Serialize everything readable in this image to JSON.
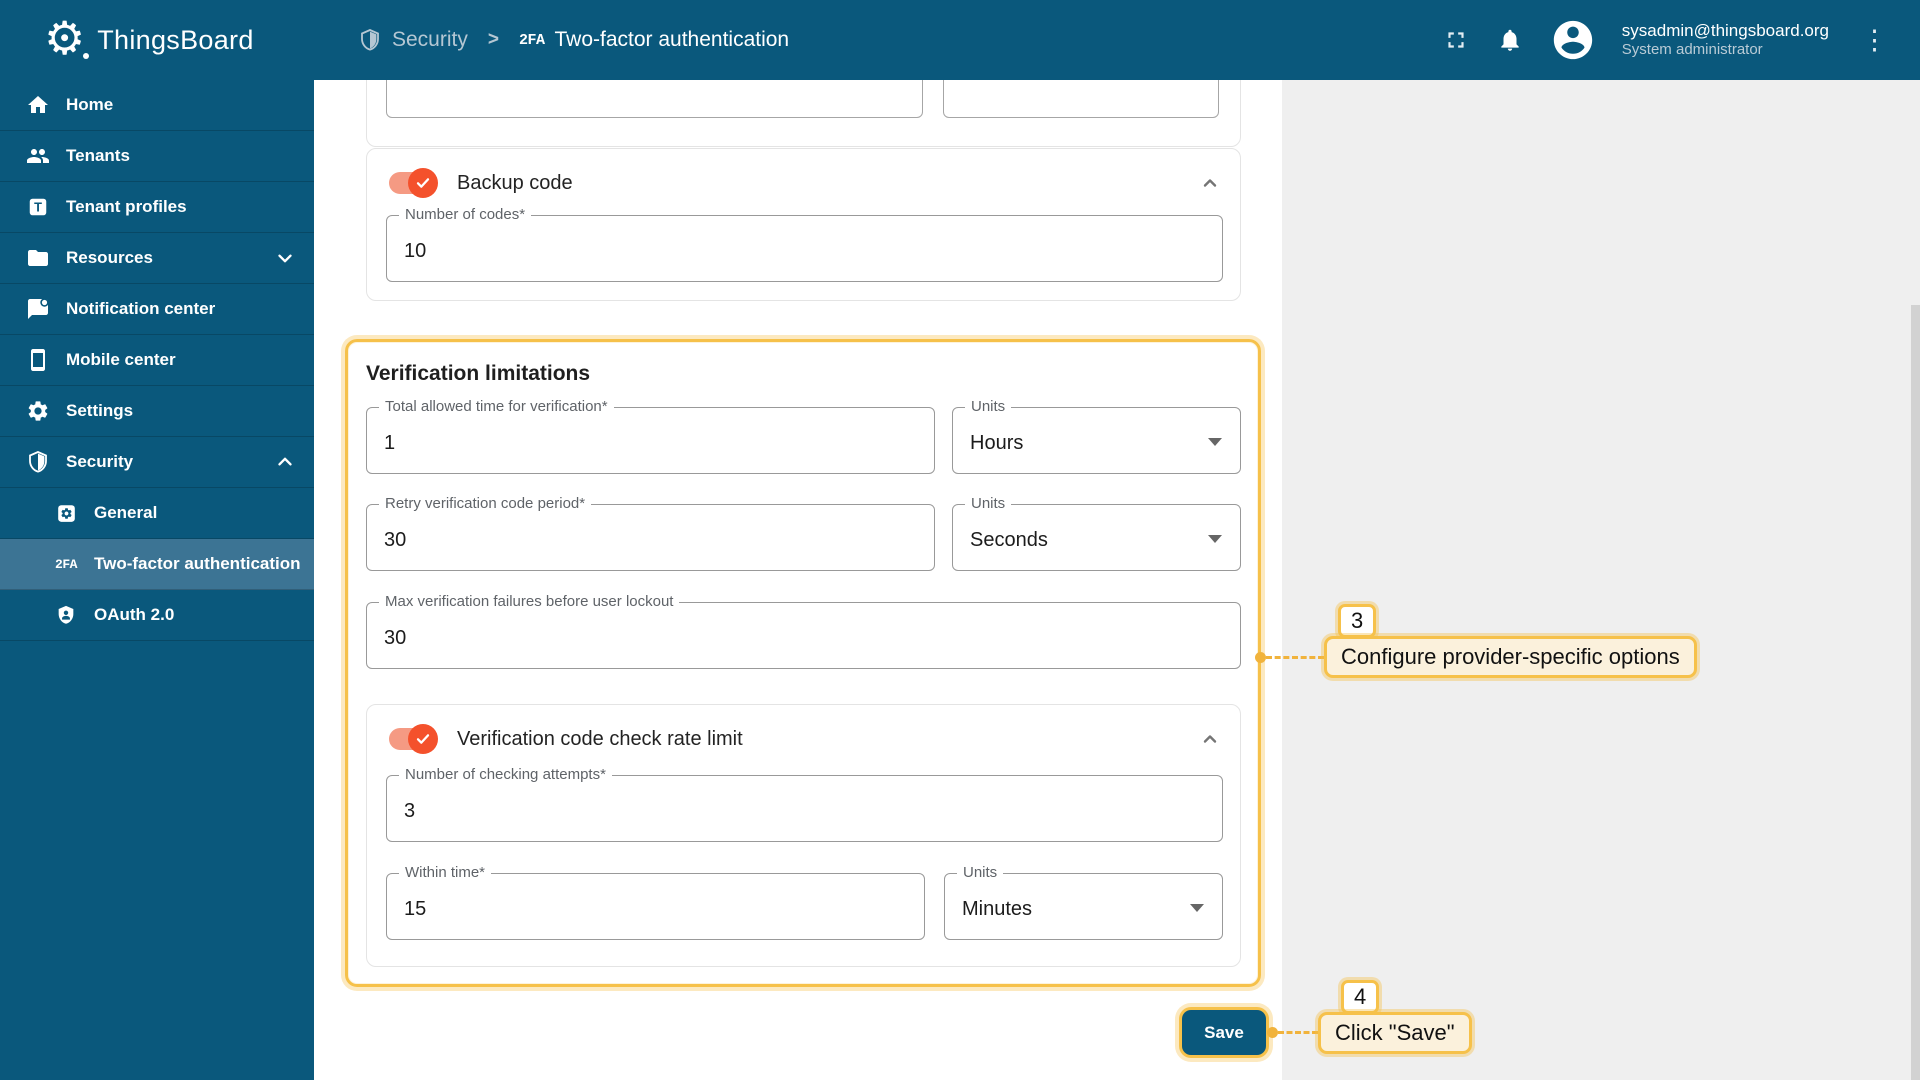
{
  "header": {
    "app_title": "ThingsBoard",
    "breadcrumb": {
      "parent": "Security",
      "separator": ">",
      "current_icon": "2FA",
      "current": "Two-factor authentication"
    },
    "user": {
      "email": "sysadmin@thingsboard.org",
      "role": "System administrator"
    }
  },
  "sidebar": {
    "items": [
      {
        "label": "Home"
      },
      {
        "label": "Tenants"
      },
      {
        "label": "Tenant profiles"
      },
      {
        "label": "Resources"
      },
      {
        "label": "Notification center"
      },
      {
        "label": "Mobile center"
      },
      {
        "label": "Settings"
      },
      {
        "label": "Security"
      },
      {
        "label": "General"
      },
      {
        "label": "Two-factor authentication",
        "icon_text": "2FA"
      },
      {
        "label": "OAuth 2.0"
      }
    ]
  },
  "content": {
    "backup_code": {
      "title": "Backup code",
      "enabled": true,
      "number_of_codes": {
        "label": "Number of codes*",
        "value": "10"
      }
    },
    "verification": {
      "title": "Verification limitations",
      "total_time": {
        "label": "Total allowed time for verification*",
        "value": "1"
      },
      "total_time_units": {
        "label": "Units",
        "value": "Hours"
      },
      "retry_period": {
        "label": "Retry verification code period*",
        "value": "30"
      },
      "retry_units": {
        "label": "Units",
        "value": "Seconds"
      },
      "max_failures": {
        "label": "Max verification failures before user lockout",
        "value": "30"
      },
      "rate_limit": {
        "title": "Verification code check rate limit",
        "enabled": true,
        "attempts": {
          "label": "Number of checking attempts*",
          "value": "3"
        },
        "within_time": {
          "label": "Within time*",
          "value": "15"
        },
        "within_units": {
          "label": "Units",
          "value": "Minutes"
        }
      }
    },
    "save_label": "Save"
  },
  "callouts": {
    "step3": {
      "number": "3",
      "text": "Configure provider-specific options"
    },
    "step4": {
      "number": "4",
      "text": "Click \"Save\""
    }
  },
  "colors": {
    "primary": "#0a587c",
    "accent_orange": "#f4512c",
    "annotation_yellow": "#f6c14a"
  }
}
